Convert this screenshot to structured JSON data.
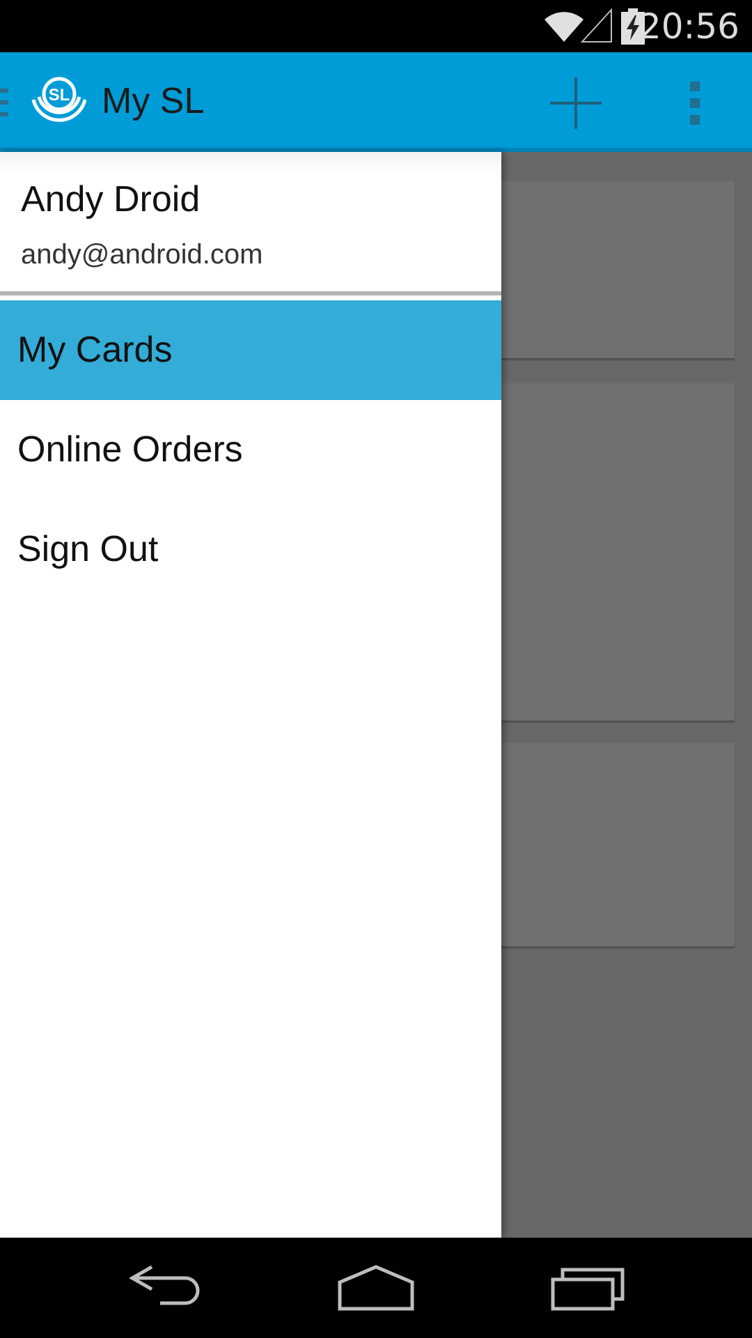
{
  "status_bar": {
    "time": "20:56",
    "icons": [
      "wifi-icon",
      "cell-signal-icon",
      "battery-charging-icon"
    ]
  },
  "action_bar": {
    "title": "My SL",
    "color": "#009cd8",
    "logo_text": "SL",
    "actions": [
      "add-icon",
      "overflow-menu-icon"
    ]
  },
  "drawer": {
    "account": {
      "name": "Andy Droid",
      "email": "andy@android.com"
    },
    "items": [
      {
        "label": "My Cards",
        "selected": true
      },
      {
        "label": "Online Orders",
        "selected": false
      },
      {
        "label": "Sign Out",
        "selected": false
      }
    ],
    "selected_color": "#33acd8"
  },
  "nav_bar": {
    "buttons": [
      "back-icon",
      "home-icon",
      "recents-icon"
    ]
  }
}
